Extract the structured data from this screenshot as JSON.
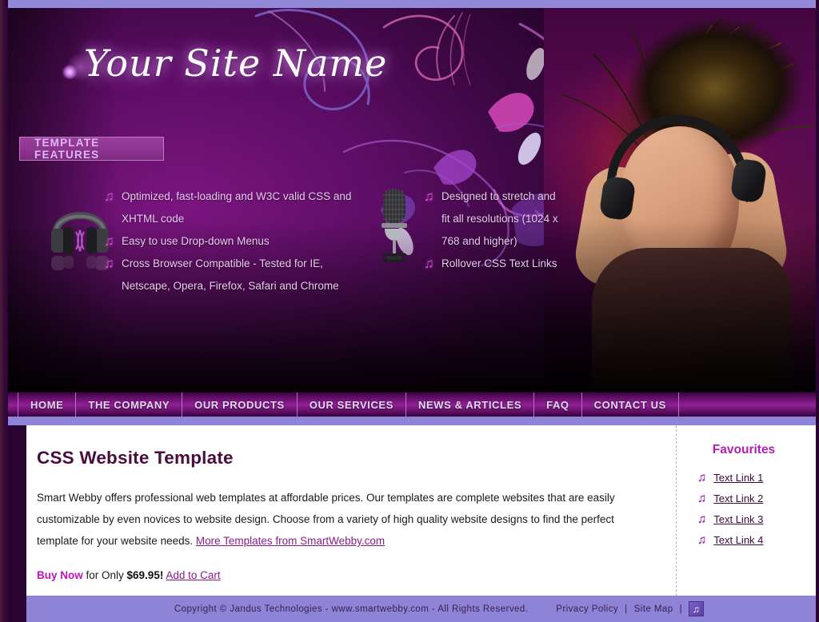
{
  "site": {
    "name": "Your Site Name"
  },
  "banner": {
    "features_label": "TEMPLATE FEATURES"
  },
  "features": {
    "column_one": {
      "icon": "headphones-icon",
      "items": [
        "Optimized, fast-loading and W3C valid CSS and XHTML code",
        "Easy to use Drop-down Menus",
        "Cross Browser Compatible - Tested for IE, Netscape, Opera, Firefox, Safari and Chrome"
      ]
    },
    "column_two": {
      "icon": "microphone-icon",
      "items": [
        "Designed to stretch and fit all resolutions (1024 x 768 and higher)",
        "Rollover CSS Text Links"
      ]
    },
    "bullet_glyph": "♫"
  },
  "nav": {
    "items": [
      {
        "label": "HOME"
      },
      {
        "label": "THE COMPANY"
      },
      {
        "label": "OUR PRODUCTS"
      },
      {
        "label": "OUR SERVICES"
      },
      {
        "label": "NEWS & ARTICLES"
      },
      {
        "label": "FAQ"
      },
      {
        "label": "CONTACT US"
      }
    ]
  },
  "main": {
    "title": "CSS Website Template",
    "paragraph_before_link": "Smart Webby offers professional web templates at affordable prices. Our templates are complete websites that are easily customizable by even novices to website design. Choose from a variety of high quality website designs to find the perfect template for your website needs. ",
    "paragraph_link": "More Templates from SmartWebby.com",
    "buy_now": "Buy Now",
    "buy_middle": " for Only ",
    "price": "$69.95!",
    "add_to_cart": "Add to Cart"
  },
  "sidebar": {
    "title": "Favourites",
    "note_glyph": "♫",
    "links": [
      {
        "label": "Text Link 1"
      },
      {
        "label": "Text Link 2"
      },
      {
        "label": "Text Link 3"
      },
      {
        "label": "Text Link 4"
      }
    ]
  },
  "footer": {
    "copyright": "Copyright © Jandus Technologies - www.smartwebby.com - All Rights Reserved.",
    "privacy_policy": "Privacy Policy",
    "separator": "|",
    "site_map": "Site Map",
    "separator_two": "|",
    "badge_glyph": "♫"
  },
  "colors": {
    "accent_purple": "#8d1a8d",
    "banner_purple": "#8d3490",
    "nav_purple": "#8f2194",
    "footer_lavender": "#8e83d6",
    "heading_maroon": "#4a0c3d",
    "buy_now_magenta": "#c112c1"
  }
}
